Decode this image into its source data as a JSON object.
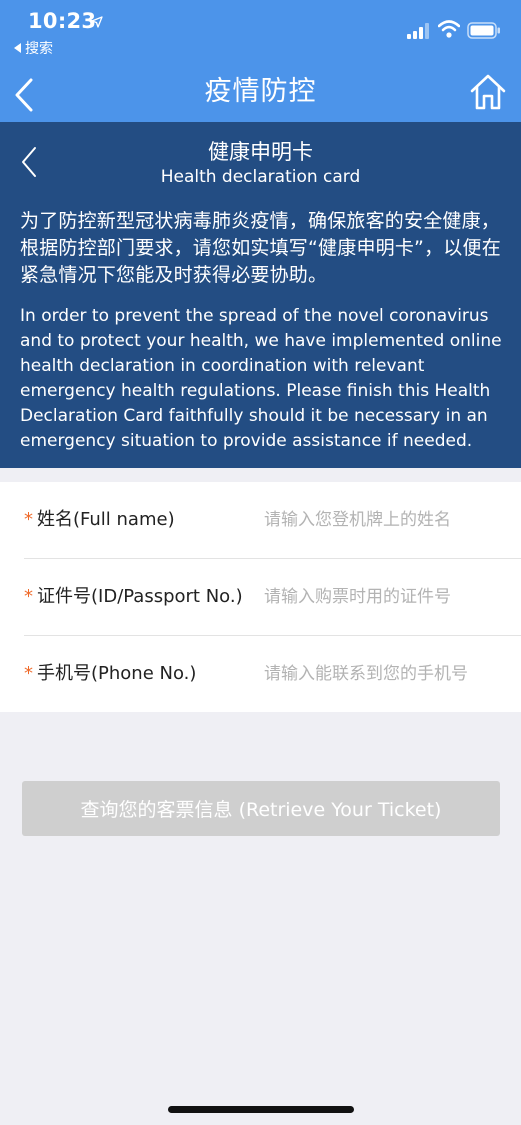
{
  "status_bar": {
    "time": "10:23",
    "back_app_label": "搜索"
  },
  "nav": {
    "title": "疫情防控"
  },
  "panel": {
    "title_zh": "健康申明卡",
    "title_en": "Health declaration card",
    "text_zh": "为了防控新型冠状病毒肺炎疫情，确保旅客的安全健康，根据防控部门要求，请您如实填写“健康申明卡”，以便在紧急情况下您能及时获得必要协助。",
    "text_en": "In order to prevent the spread of the novel coronavirus and to protect your health, we have implemented online health declaration in coordination with relevant emergency health regulations. Please finish this Health Declaration Card faithfully should it be necessary in an emergency situation to provide assistance if needed."
  },
  "form": {
    "required_mark": "*",
    "fields": [
      {
        "label": "姓名(Full name)",
        "placeholder": "请输入您登机牌上的姓名",
        "value": ""
      },
      {
        "label": "证件号(ID/Passport No.)",
        "placeholder": "请输入购票时用的证件号",
        "value": ""
      },
      {
        "label": "手机号(Phone No.)",
        "placeholder": "请输入能联系到您的手机号",
        "value": ""
      }
    ]
  },
  "retrieve_button": {
    "label": "查询您的客票信息 (Retrieve Your Ticket)"
  },
  "colors": {
    "nav_blue": "#4c94ea",
    "panel_blue": "#234d83",
    "required_orange": "#ef6a2a",
    "button_disabled": "#cfcfcf"
  }
}
